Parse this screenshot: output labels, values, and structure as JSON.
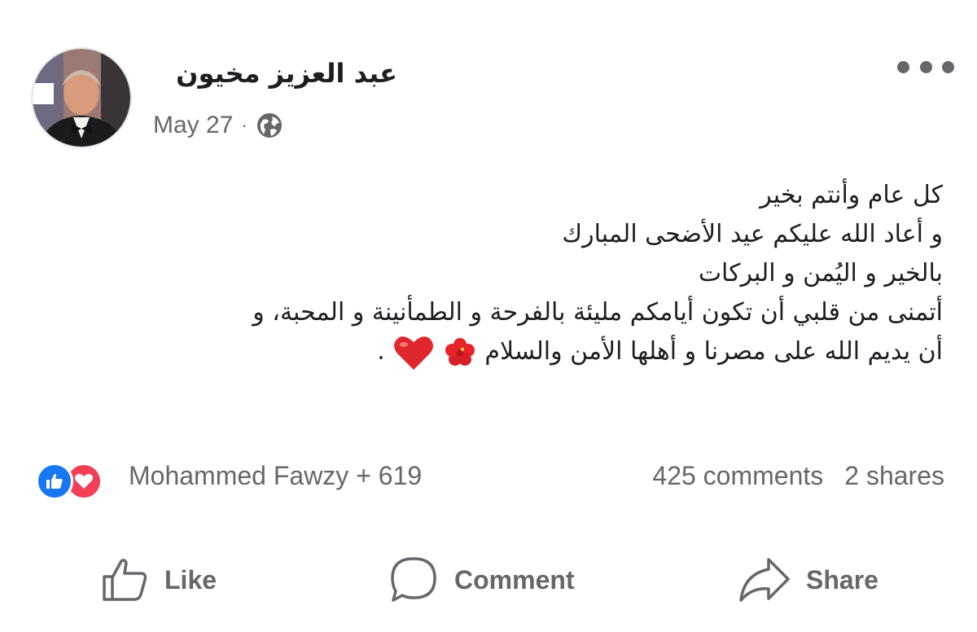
{
  "post": {
    "author": "عبد العزيز مخيون",
    "date": "May 27",
    "separator": "·",
    "privacy_icon": "globe-icon",
    "more_icon": "more-options-icon",
    "lines": [
      "كل عام وأنتم بخير",
      "و أعاد الله عليكم عيد الأضحى المبارك",
      "بالخير و اليُمن و البركات",
      "أتمنى من قلبي أن تكون أيامكم مليئة بالفرحة و الطمأنينة و المحبة، و",
      "أن يديم الله على مصرنا و أهلها الأمن والسلام"
    ],
    "last_line_end": ".",
    "emojis": [
      "hibiscus-emoji",
      "red-heart-emoji"
    ]
  },
  "stats": {
    "reaction_icons": [
      "like-reaction",
      "love-reaction"
    ],
    "reactors": "Mohammed Fawzy + 619",
    "comments": "425 comments",
    "shares": "2 shares"
  },
  "actions": {
    "like": "Like",
    "comment": "Comment",
    "share": "Share"
  },
  "colors": {
    "text": "#1c1e21",
    "secondary": "#65676b",
    "like_blue": "#1877f2",
    "love_red": "#f33e58"
  }
}
